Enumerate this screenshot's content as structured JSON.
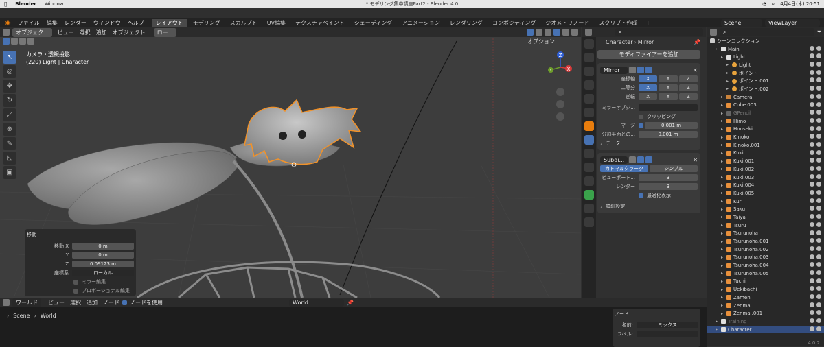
{
  "mac": {
    "app": "Blender",
    "menu_window": "Window",
    "title": "* モデリング集中講座Part2 - Blender 4.0",
    "clock": "4月4日(木) 20:51"
  },
  "topbar": {
    "menus": [
      "ファイル",
      "編集",
      "レンダー",
      "ウィンドウ",
      "ヘルプ"
    ],
    "workspaces": [
      "レイアウト",
      "モデリング",
      "スカルプト",
      "UV編集",
      "テクスチャペイント",
      "シェーディング",
      "アニメーション",
      "レンダリング",
      "コンポジティング",
      "ジオメトリノード",
      "スクリプト作成"
    ],
    "active_workspace": 0,
    "scene": "Scene",
    "viewlayer": "ViewLayer"
  },
  "viewport_header": {
    "mode": "オブジェク...",
    "menus": [
      "ビュー",
      "選択",
      "追加",
      "オブジェクト"
    ],
    "orientation": "ロー...",
    "options": "オプション"
  },
  "viewport_info": {
    "line1": "カメラ・透視投影",
    "line2": "(220) Light | Character"
  },
  "gizmo": {
    "z": "Z",
    "y": "Y",
    "x": "X"
  },
  "operator": {
    "title": "移動",
    "x_label": "移動 X",
    "x_value": "0 m",
    "y_label": "Y",
    "y_value": "0 m",
    "z_label": "Z",
    "z_value": "0.09123 m",
    "coord_label": "座標系",
    "coord_value": "ローカル",
    "mirror": "ミラー編集",
    "proportional": "プロポーショナル編集"
  },
  "props": {
    "breadcrumb_obj": "Character",
    "breadcrumb_mod": "Mirror",
    "add_modifier": "モディファイアーを追加",
    "mirror": {
      "name": "Mirror",
      "axis_label": "座標軸",
      "bisect_label": "二等分",
      "flip_label": "逆転",
      "xyz": [
        "X",
        "Y",
        "Z"
      ],
      "mirror_obj_label": "ミラーオブジ...",
      "clipping": "クリッピング",
      "merge_label": "マージ",
      "merge_value": "0.001 m",
      "bisect_dist_label": "分割平面との...",
      "bisect_dist_value": "0.001 m",
      "data": "データ"
    },
    "subdiv": {
      "name": "Subdi...",
      "catmull": "カトマルクラーク",
      "simple": "シンプル",
      "viewport_label": "ビューポート...",
      "viewport_value": "3",
      "render_label": "レンダー",
      "render_value": "3",
      "optimal": "最適化表示",
      "advanced": "詳細設定"
    }
  },
  "outliner": {
    "title": "シーンコレクション",
    "rows": [
      {
        "label": "Main",
        "indent": 1,
        "type": "coll"
      },
      {
        "label": "Light",
        "indent": 2,
        "type": "coll"
      },
      {
        "label": "Light",
        "indent": 3,
        "type": "light"
      },
      {
        "label": "ポイント",
        "indent": 3,
        "type": "light"
      },
      {
        "label": "ポイント.001",
        "indent": 3,
        "type": "light"
      },
      {
        "label": "ポイント.002",
        "indent": 3,
        "type": "light"
      },
      {
        "label": "Camera",
        "indent": 2,
        "type": "cam"
      },
      {
        "label": "Cube.003",
        "indent": 2,
        "type": "mesh"
      },
      {
        "label": "GPencil",
        "indent": 2,
        "type": "gp"
      },
      {
        "label": "Himo",
        "indent": 2,
        "type": "curve"
      },
      {
        "label": "Houseki",
        "indent": 2,
        "type": "mesh"
      },
      {
        "label": "Kinoko",
        "indent": 2,
        "type": "mesh"
      },
      {
        "label": "Kinoko.001",
        "indent": 2,
        "type": "mesh"
      },
      {
        "label": "Kuki",
        "indent": 2,
        "type": "curve"
      },
      {
        "label": "Kuki.001",
        "indent": 2,
        "type": "curve"
      },
      {
        "label": "Kuki.002",
        "indent": 2,
        "type": "curve"
      },
      {
        "label": "Kuki.003",
        "indent": 2,
        "type": "curve"
      },
      {
        "label": "Kuki.004",
        "indent": 2,
        "type": "curve"
      },
      {
        "label": "Kuki.005",
        "indent": 2,
        "type": "curve"
      },
      {
        "label": "Kuri",
        "indent": 2,
        "type": "mesh"
      },
      {
        "label": "Saku",
        "indent": 2,
        "type": "curve"
      },
      {
        "label": "Taiya",
        "indent": 2,
        "type": "curve"
      },
      {
        "label": "Tsuru",
        "indent": 2,
        "type": "curve"
      },
      {
        "label": "Tsurunoha",
        "indent": 2,
        "type": "mesh"
      },
      {
        "label": "Tsurunoha.001",
        "indent": 2,
        "type": "mesh"
      },
      {
        "label": "Tsurunoha.002",
        "indent": 2,
        "type": "mesh"
      },
      {
        "label": "Tsurunoha.003",
        "indent": 2,
        "type": "mesh"
      },
      {
        "label": "Tsurunoha.004",
        "indent": 2,
        "type": "mesh"
      },
      {
        "label": "Tsurunoha.005",
        "indent": 2,
        "type": "mesh"
      },
      {
        "label": "Tuchi",
        "indent": 2,
        "type": "mesh"
      },
      {
        "label": "Uekibachi",
        "indent": 2,
        "type": "mesh"
      },
      {
        "label": "Zamen",
        "indent": 2,
        "type": "curve"
      },
      {
        "label": "Zenmai",
        "indent": 2,
        "type": "curve"
      },
      {
        "label": "Zenmai.001",
        "indent": 2,
        "type": "curve"
      },
      {
        "label": "Training",
        "indent": 1,
        "type": "coll"
      },
      {
        "label": "Character",
        "indent": 1,
        "type": "coll"
      }
    ]
  },
  "node_header": {
    "world": "ワールド",
    "menus": [
      "ビュー",
      "選択",
      "追加",
      "ノード"
    ],
    "use_nodes": "ノードを使用",
    "world_name": "World"
  },
  "node_breadcrumb": {
    "scene": "Scene",
    "world": "World"
  },
  "node_side": {
    "title": "ノード",
    "name_label": "名前:",
    "name_value": "ミックス",
    "label_label": "ラベル:"
  },
  "version": "4.0.2"
}
